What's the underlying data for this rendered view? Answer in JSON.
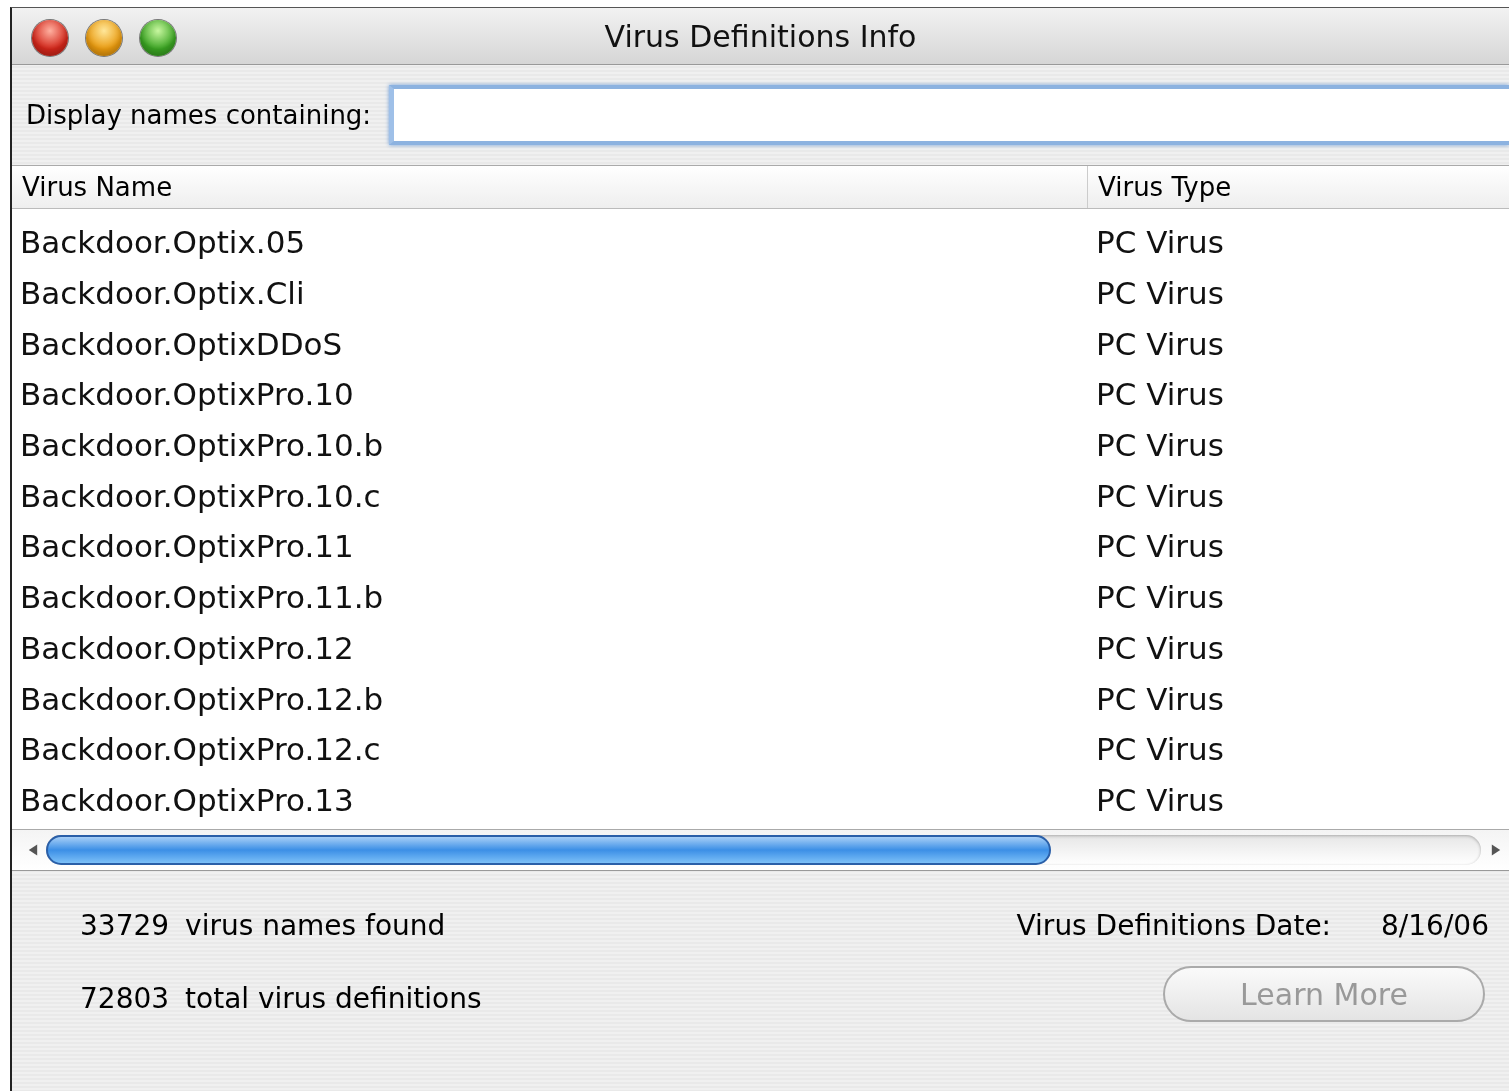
{
  "window": {
    "title": "Virus Definitions Info"
  },
  "filter": {
    "label": "Display names containing:"
  },
  "table": {
    "columns": [
      "Virus Name",
      "Virus Type"
    ],
    "rows": [
      {
        "name": "Backdoor.Optix.05",
        "type": "PC Virus"
      },
      {
        "name": "Backdoor.Optix.Cli",
        "type": "PC Virus"
      },
      {
        "name": "Backdoor.OptixDDoS",
        "type": "PC Virus"
      },
      {
        "name": "Backdoor.OptixPro.10",
        "type": "PC Virus"
      },
      {
        "name": "Backdoor.OptixPro.10.b",
        "type": "PC Virus"
      },
      {
        "name": "Backdoor.OptixPro.10.c",
        "type": "PC Virus"
      },
      {
        "name": "Backdoor.OptixPro.11",
        "type": "PC Virus"
      },
      {
        "name": "Backdoor.OptixPro.11.b",
        "type": "PC Virus"
      },
      {
        "name": "Backdoor.OptixPro.12",
        "type": "PC Virus"
      },
      {
        "name": "Backdoor.OptixPro.12.b",
        "type": "PC Virus"
      },
      {
        "name": "Backdoor.OptixPro.12.c",
        "type": "PC Virus"
      },
      {
        "name": "Backdoor.OptixPro.13",
        "type": "PC Virus"
      }
    ]
  },
  "stats": [
    {
      "count": "33729",
      "label": "virus names found"
    },
    {
      "count": "72803",
      "label": "total virus definitions"
    }
  ],
  "definitions_date": {
    "label": "Virus Definitions Date:",
    "value": "8/16/06"
  },
  "learn_more": {
    "label": "Learn More",
    "disabled": true
  }
}
